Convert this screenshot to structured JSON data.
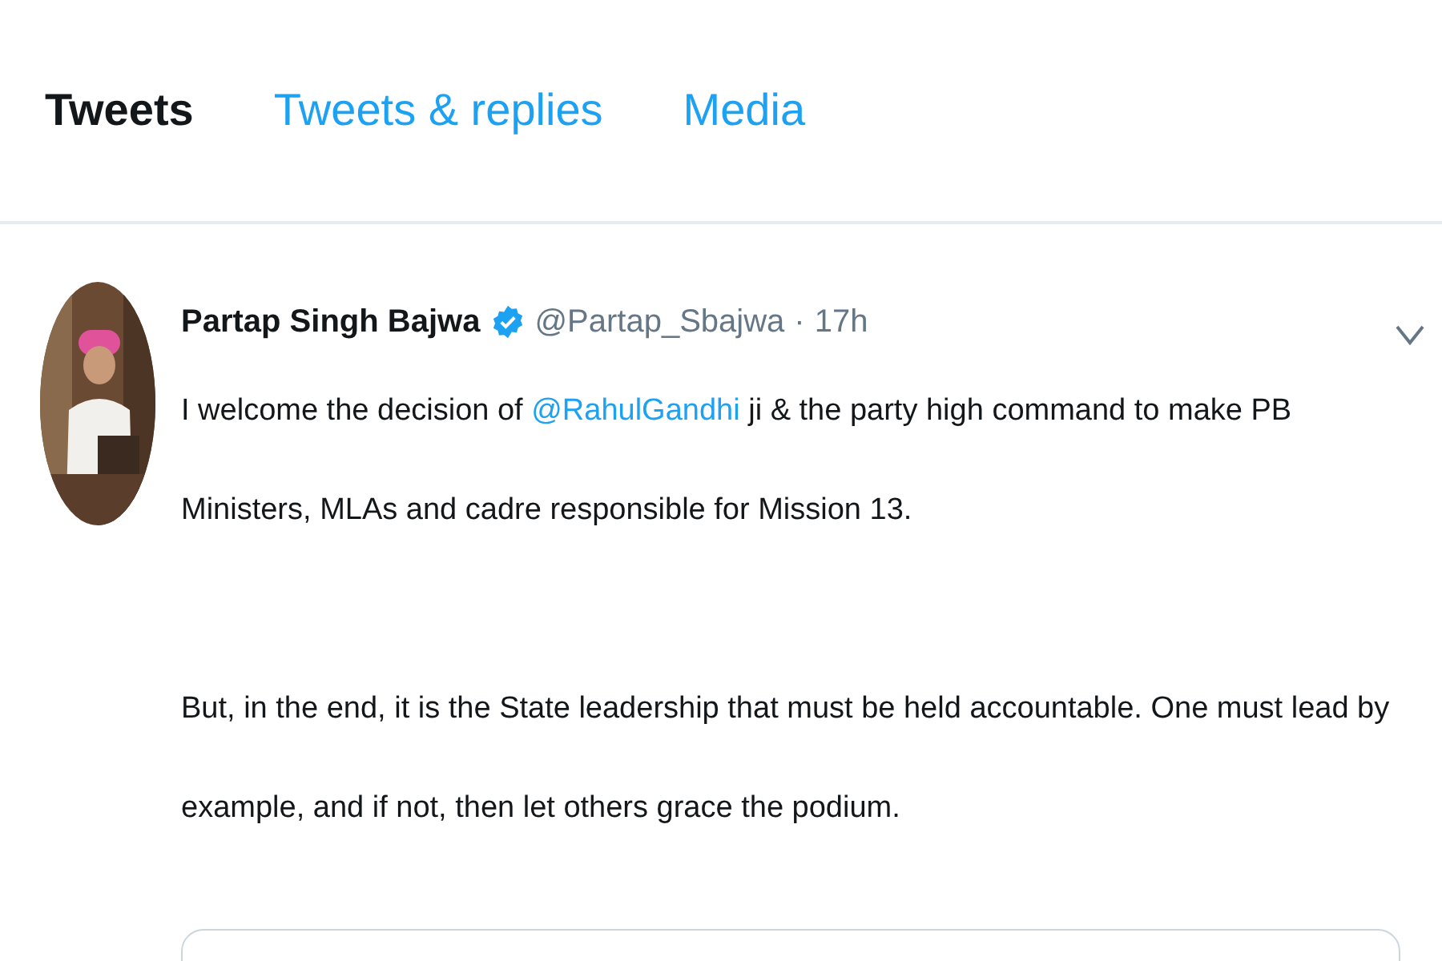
{
  "tabs": [
    {
      "label": "Tweets",
      "selected": true
    },
    {
      "label": "Tweets & replies",
      "selected": false
    },
    {
      "label": "Media",
      "selected": false
    }
  ],
  "tweet": {
    "name": "Partap Singh Bajwa",
    "verified": true,
    "handle": "@Partap_Sbajwa",
    "separator": "·",
    "time": "17h",
    "paragraphs": [
      [
        {
          "kind": "text",
          "text": "I welcome the decision of "
        },
        {
          "kind": "mention",
          "text": "@RahulGandhi"
        },
        {
          "kind": "text",
          "text": " ji & the party high command to make PB Ministers, MLAs and cadre responsible for Mission 13."
        }
      ],
      [
        {
          "kind": "text",
          "text": "But, in the end, it is the State leadership that must be held accountable. One must lead by example, and if not, then let others grace the podium."
        }
      ]
    ],
    "card": {
      "kind": "link"
    }
  }
}
